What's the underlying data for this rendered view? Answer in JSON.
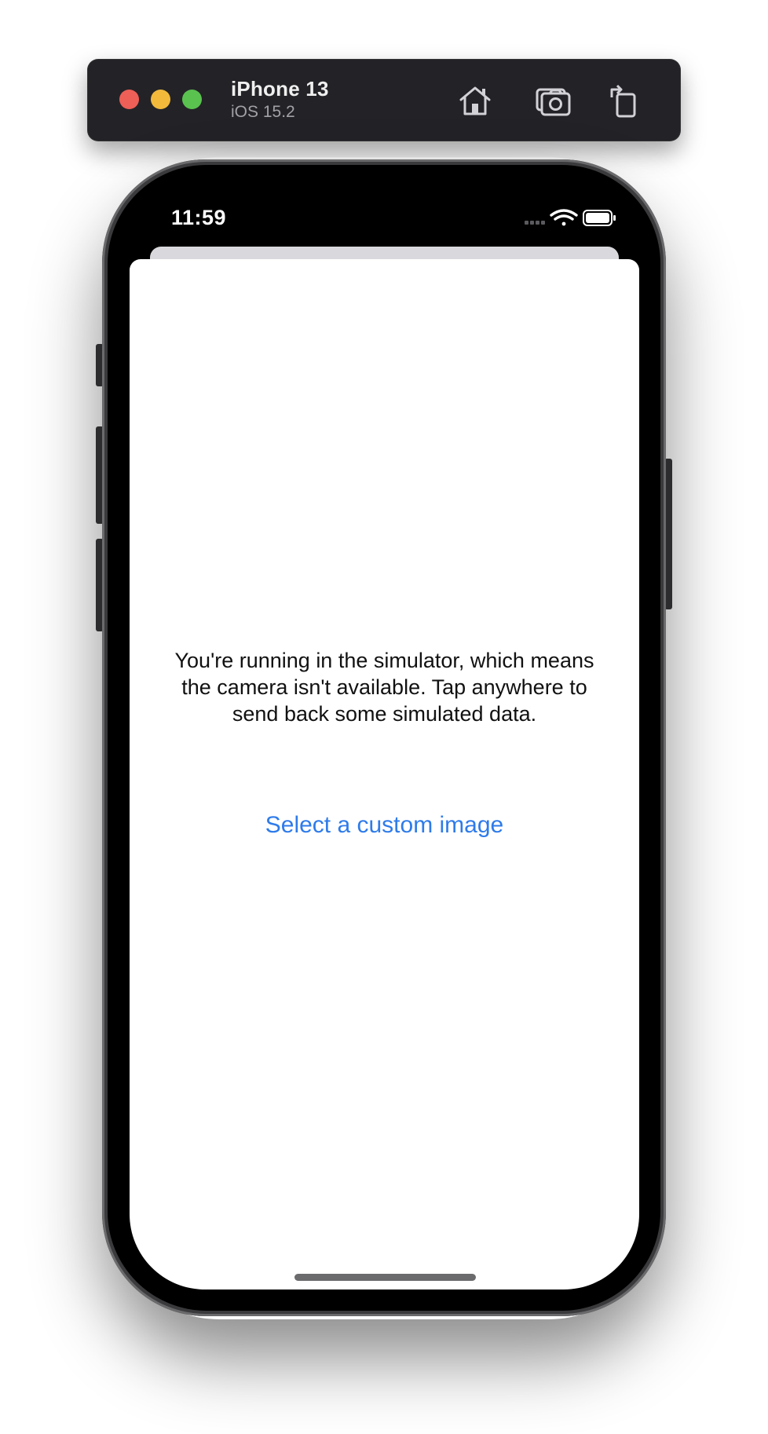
{
  "simulator": {
    "device_name": "iPhone 13",
    "os_version": "iOS 15.2",
    "toolbar_icons": [
      "home-icon",
      "screenshot-icon",
      "rotate-icon"
    ]
  },
  "status_bar": {
    "time": "11:59",
    "icons": [
      "signal-icon",
      "wifi-icon",
      "battery-icon"
    ]
  },
  "content": {
    "message": "You're running in the simulator, which means the camera isn't available. Tap anywhere to send back some simulated data.",
    "custom_image_link": "Select a custom image"
  },
  "colors": {
    "link": "#2e7bea",
    "traffic_red": "#ee5f57",
    "traffic_yellow": "#f2b93b",
    "traffic_green": "#5ac24f",
    "toolbar_bg": "#232327"
  }
}
